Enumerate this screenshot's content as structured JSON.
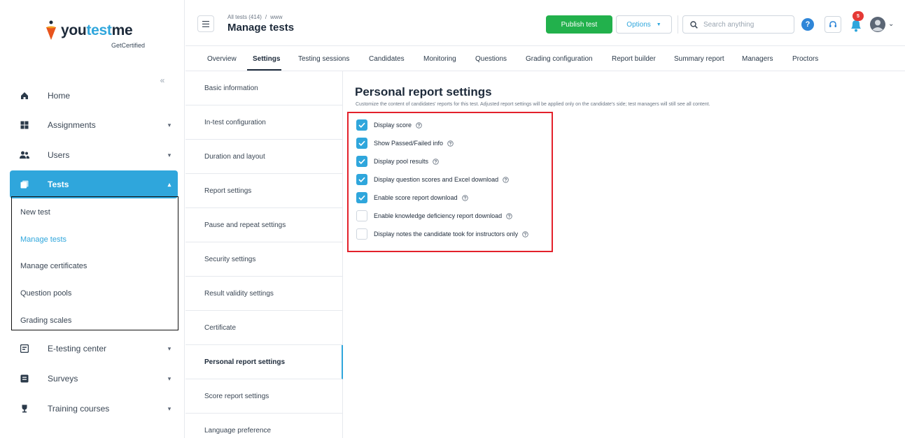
{
  "logo": {
    "brand_prefix": "you",
    "brand_accent": "test",
    "brand_suffix": "me",
    "tagline": "GetCertified"
  },
  "sidebar": {
    "collapse_glyph": "«",
    "items": [
      {
        "label": "Home",
        "icon": "home-icon"
      },
      {
        "label": "Assignments",
        "icon": "assignments-icon",
        "caret": "▾"
      },
      {
        "label": "Users",
        "icon": "users-icon",
        "caret": "▾"
      },
      {
        "label": "Tests",
        "icon": "tests-icon",
        "caret": "▴"
      },
      {
        "label": "E-testing center",
        "icon": "e-testing-icon",
        "caret": "▾"
      },
      {
        "label": "Surveys",
        "icon": "surveys-icon",
        "caret": "▾"
      },
      {
        "label": "Training courses",
        "icon": "trophy-icon",
        "caret": "▾"
      }
    ],
    "submenu": [
      "New test",
      "Manage tests",
      "Manage certificates",
      "Question pools",
      "Grading scales"
    ],
    "submenu_active": "Manage tests"
  },
  "header": {
    "breadcrumb_parent": "All tests (414)",
    "breadcrumb_sep": "/",
    "breadcrumb_current": "www",
    "title": "Manage tests",
    "publish_label": "Publish test",
    "options_label": "Options",
    "options_caret": "▼",
    "search_placeholder": "Search anything",
    "help_glyph": "?",
    "notification_count": "5",
    "avatar_caret": "⌄"
  },
  "tabs": [
    "Overview",
    "Settings",
    "Testing sessions",
    "Candidates",
    "Monitoring",
    "Questions",
    "Grading configuration",
    "Report builder",
    "Summary report",
    "Managers",
    "Proctors"
  ],
  "active_tab": "Settings",
  "settings_menu": [
    "Basic information",
    "In-test configuration",
    "Duration and layout",
    "Report settings",
    "Pause and repeat settings",
    "Security settings",
    "Result validity settings",
    "Certificate",
    "Personal report settings",
    "Score report settings",
    "Language preference"
  ],
  "settings_menu_active": "Personal report settings",
  "section": {
    "title": "Personal report settings",
    "description": "Customize the content of candidates' reports for this test. Adjusted report settings will be applied only on the candidate's side; test managers will still see all content.",
    "options": [
      {
        "label": "Display score",
        "checked": true
      },
      {
        "label": "Show Passed/Failed info",
        "checked": true
      },
      {
        "label": "Display pool results",
        "checked": true
      },
      {
        "label": "Display question scores and Excel download",
        "checked": true
      },
      {
        "label": "Enable score report download",
        "checked": true
      },
      {
        "label": "Enable knowledge deficiency report download",
        "checked": false
      },
      {
        "label": "Display notes the candidate took for instructors only",
        "checked": false
      }
    ]
  },
  "colors": {
    "accent": "#2fa6dc",
    "publish": "#22b14c",
    "highlight_box": "#e3212b",
    "badge": "#e53935"
  }
}
